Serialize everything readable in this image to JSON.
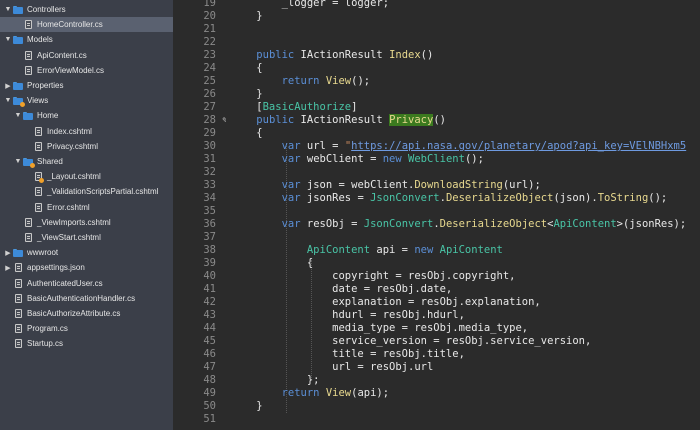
{
  "sidebar": {
    "items": [
      {
        "label": "Controllers",
        "kind": "folder",
        "expanded": true,
        "indent": 1,
        "badge": false
      },
      {
        "label": "HomeController.cs",
        "kind": "file",
        "indent": 2,
        "selected": true,
        "badge": false
      },
      {
        "label": "Models",
        "kind": "folder",
        "expanded": true,
        "indent": 1,
        "badge": false
      },
      {
        "label": "ApiContent.cs",
        "kind": "file",
        "indent": 2,
        "badge": false
      },
      {
        "label": "ErrorViewModel.cs",
        "kind": "file",
        "indent": 2,
        "badge": false
      },
      {
        "label": "Properties",
        "kind": "folder",
        "expanded": false,
        "indent": 1,
        "badge": false
      },
      {
        "label": "Views",
        "kind": "folder",
        "expanded": true,
        "indent": 1,
        "badge": true
      },
      {
        "label": "Home",
        "kind": "folder",
        "expanded": true,
        "indent": 2,
        "badge": false
      },
      {
        "label": "Index.cshtml",
        "kind": "file",
        "indent": 3,
        "badge": false
      },
      {
        "label": "Privacy.cshtml",
        "kind": "file",
        "indent": 3,
        "badge": false
      },
      {
        "label": "Shared",
        "kind": "folder",
        "expanded": true,
        "indent": 2,
        "badge": true
      },
      {
        "label": "_Layout.cshtml",
        "kind": "file",
        "indent": 3,
        "badge": true
      },
      {
        "label": "_ValidationScriptsPartial.cshtml",
        "kind": "file",
        "indent": 3,
        "badge": false
      },
      {
        "label": "Error.cshtml",
        "kind": "file",
        "indent": 3,
        "badge": false
      },
      {
        "label": "_ViewImports.cshtml",
        "kind": "file",
        "indent": 2,
        "badge": false
      },
      {
        "label": "_ViewStart.cshtml",
        "kind": "file",
        "indent": 2,
        "badge": false
      },
      {
        "label": "wwwroot",
        "kind": "folder",
        "expanded": false,
        "indent": 1,
        "badge": false
      },
      {
        "label": "appsettings.json",
        "kind": "file",
        "expanded": false,
        "indent": 1,
        "hasArrow": true,
        "badge": false
      },
      {
        "label": "AuthenticatedUser.cs",
        "kind": "file",
        "indent": 1,
        "badge": false
      },
      {
        "label": "BasicAuthenticationHandler.cs",
        "kind": "file",
        "indent": 1,
        "badge": false
      },
      {
        "label": "BasicAuthorizeAttribute.cs",
        "kind": "file",
        "indent": 1,
        "badge": false
      },
      {
        "label": "Program.cs",
        "kind": "file",
        "indent": 1,
        "badge": false
      },
      {
        "label": "Startup.cs",
        "kind": "file",
        "indent": 1,
        "badge": false
      }
    ]
  },
  "editor": {
    "line_numbers": [
      "19",
      "20",
      "21",
      "22",
      "23",
      "24",
      "25",
      "26",
      "27",
      "28",
      "29",
      "30",
      "31",
      "32",
      "33",
      "34",
      "35",
      "36",
      "37",
      "38",
      "39",
      "40",
      "41",
      "42",
      "43",
      "44",
      "45",
      "46",
      "47",
      "48",
      "49",
      "50",
      "51"
    ],
    "lines": [
      [
        {
          "t": "        _logger = logger;",
          "c": ""
        }
      ],
      [
        {
          "t": "    }",
          "c": ""
        }
      ],
      [],
      [],
      [
        {
          "t": "    ",
          "c": ""
        },
        {
          "t": "public",
          "c": "kw"
        },
        {
          "t": " IActionResult ",
          "c": ""
        },
        {
          "t": "Index",
          "c": "method"
        },
        {
          "t": "()",
          "c": ""
        }
      ],
      [
        {
          "t": "    {",
          "c": ""
        }
      ],
      [
        {
          "t": "        ",
          "c": ""
        },
        {
          "t": "return",
          "c": "kw"
        },
        {
          "t": " ",
          "c": ""
        },
        {
          "t": "View",
          "c": "method"
        },
        {
          "t": "();",
          "c": ""
        }
      ],
      [
        {
          "t": "    }",
          "c": ""
        }
      ],
      [
        {
          "t": "    [",
          "c": ""
        },
        {
          "t": "BasicAuthorize",
          "c": "type"
        },
        {
          "t": "]",
          "c": ""
        }
      ],
      [
        {
          "t": "    ",
          "c": ""
        },
        {
          "t": "public",
          "c": "kw"
        },
        {
          "t": " IActionResult ",
          "c": ""
        },
        {
          "t": "Privacy",
          "c": "hl"
        },
        {
          "t": "()",
          "c": ""
        }
      ],
      [
        {
          "t": "    {",
          "c": ""
        }
      ],
      [
        {
          "t": "        ",
          "c": ""
        },
        {
          "t": "var",
          "c": "kw"
        },
        {
          "t": " url = ",
          "c": ""
        },
        {
          "t": "\"",
          "c": "str"
        },
        {
          "t": "https://api.nasa.gov/planetary/apod?api_key=VElNBHxm5",
          "c": "url"
        }
      ],
      [
        {
          "t": "        ",
          "c": ""
        },
        {
          "t": "var",
          "c": "kw"
        },
        {
          "t": " webClient = ",
          "c": ""
        },
        {
          "t": "new",
          "c": "kw"
        },
        {
          "t": " ",
          "c": ""
        },
        {
          "t": "WebClient",
          "c": "type"
        },
        {
          "t": "();",
          "c": ""
        }
      ],
      [],
      [
        {
          "t": "        ",
          "c": ""
        },
        {
          "t": "var",
          "c": "kw"
        },
        {
          "t": " json = webClient.",
          "c": ""
        },
        {
          "t": "DownloadString",
          "c": "method"
        },
        {
          "t": "(url);",
          "c": ""
        }
      ],
      [
        {
          "t": "        ",
          "c": ""
        },
        {
          "t": "var",
          "c": "kw"
        },
        {
          "t": " jsonRes = ",
          "c": ""
        },
        {
          "t": "JsonConvert",
          "c": "type"
        },
        {
          "t": ".",
          "c": ""
        },
        {
          "t": "DeserializeObject",
          "c": "method"
        },
        {
          "t": "(json).",
          "c": ""
        },
        {
          "t": "ToString",
          "c": "method"
        },
        {
          "t": "();",
          "c": ""
        }
      ],
      [],
      [
        {
          "t": "        ",
          "c": ""
        },
        {
          "t": "var",
          "c": "kw"
        },
        {
          "t": " resObj = ",
          "c": ""
        },
        {
          "t": "JsonConvert",
          "c": "type"
        },
        {
          "t": ".",
          "c": ""
        },
        {
          "t": "DeserializeObject",
          "c": "method"
        },
        {
          "t": "<",
          "c": ""
        },
        {
          "t": "ApiContent",
          "c": "type"
        },
        {
          "t": ">(jsonRes);",
          "c": ""
        }
      ],
      [],
      [
        {
          "t": "            ",
          "c": ""
        },
        {
          "t": "ApiContent",
          "c": "type"
        },
        {
          "t": " api = ",
          "c": ""
        },
        {
          "t": "new",
          "c": "kw"
        },
        {
          "t": " ",
          "c": ""
        },
        {
          "t": "ApiContent",
          "c": "type"
        }
      ],
      [
        {
          "t": "            {",
          "c": ""
        }
      ],
      [
        {
          "t": "                copyright = resObj.copyright,",
          "c": ""
        }
      ],
      [
        {
          "t": "                date = resObj.date,",
          "c": ""
        }
      ],
      [
        {
          "t": "                explanation = resObj.explanation,",
          "c": ""
        }
      ],
      [
        {
          "t": "                hdurl = resObj.hdurl,",
          "c": ""
        }
      ],
      [
        {
          "t": "                media_type = resObj.media_type,",
          "c": ""
        }
      ],
      [
        {
          "t": "                service_version = resObj.service_version,",
          "c": ""
        }
      ],
      [
        {
          "t": "                title = resObj.title,",
          "c": ""
        }
      ],
      [
        {
          "t": "                url = resObj.url",
          "c": ""
        }
      ],
      [
        {
          "t": "            };",
          "c": ""
        }
      ],
      [
        {
          "t": "        ",
          "c": ""
        },
        {
          "t": "return",
          "c": "kw"
        },
        {
          "t": " ",
          "c": ""
        },
        {
          "t": "View",
          "c": "method"
        },
        {
          "t": "(api);",
          "c": ""
        }
      ],
      [
        {
          "t": "    }",
          "c": ""
        }
      ],
      []
    ]
  }
}
